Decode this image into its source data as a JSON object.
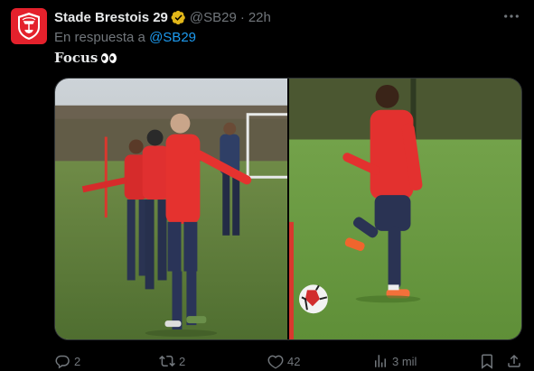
{
  "post": {
    "author_name": "Stade Brestois 29",
    "handle": "@SB29",
    "separator": "·",
    "time": "22h",
    "reply_prefix": "En respuesta a",
    "reply_mention": "@SB29",
    "text": "Focus",
    "text_emoji": "eyes-emoji",
    "more_icon": "ellipsis-icon"
  },
  "actions": {
    "replies": "2",
    "reposts": "2",
    "likes": "42",
    "views": "3 mil"
  },
  "colors": {
    "brand_red": "#e4212c",
    "link_blue": "#1d9bf0",
    "muted": "#71767b",
    "verified_gold": "#e2b719"
  }
}
